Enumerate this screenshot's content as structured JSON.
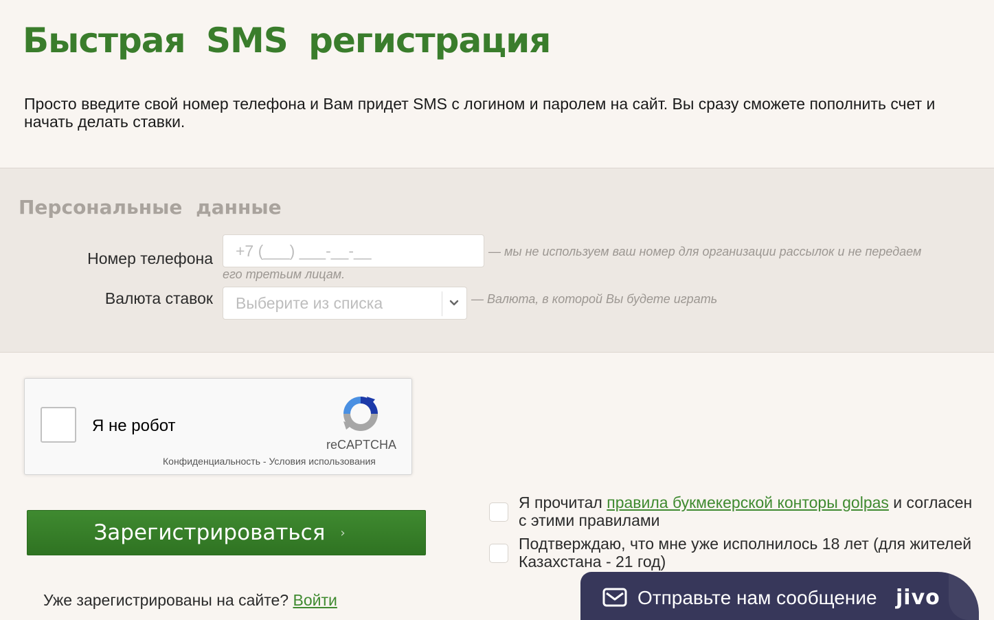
{
  "header": {
    "title": "Быстрая SMS регистрация",
    "intro": "Просто введите свой номер телефона и Вам придет SMS с логином и паролем на сайт. Вы сразу сможете пополнить счет и начать делать ставки."
  },
  "personal": {
    "section_title": "Персональные данные",
    "phone_label": "Номер телефона",
    "phone_placeholder": "+7 (___) ___-__-__",
    "phone_hint_line1": "— мы не используем ваш номер для организации рассылок и не передаем",
    "phone_hint_line2": "его третьим лицам.",
    "currency_label": "Валюта ставок",
    "currency_selected": "Выберите из списка",
    "currency_hint": "— Валюта, в которой Вы будете играть"
  },
  "recaptcha": {
    "label": "Я не робот",
    "brand": "reCAPTCHA",
    "privacy": "Конфиденциальность",
    "separator": " - ",
    "terms": "Условия использования"
  },
  "actions": {
    "register_label": "Зарегистрироваться",
    "already_text": "Уже зарегистрированы на сайте?",
    "login_link": "Войти"
  },
  "agreements": {
    "rules_prefix": "Я прочитал ",
    "rules_link": "правила букмекерской конторы golpas",
    "rules_suffix": " и согласен с этими правилами",
    "age_text": "Подтверждаю, что мне уже исполнилось 18 лет (для жителей Казахстана - 21 год)"
  },
  "chat": {
    "text": "Отправьте нам сообщение",
    "brand": "jivo"
  },
  "colors": {
    "accent": "#3a7d2c",
    "background": "#f9f5f1",
    "panel": "#ede8e3",
    "chat": "#37375a"
  }
}
